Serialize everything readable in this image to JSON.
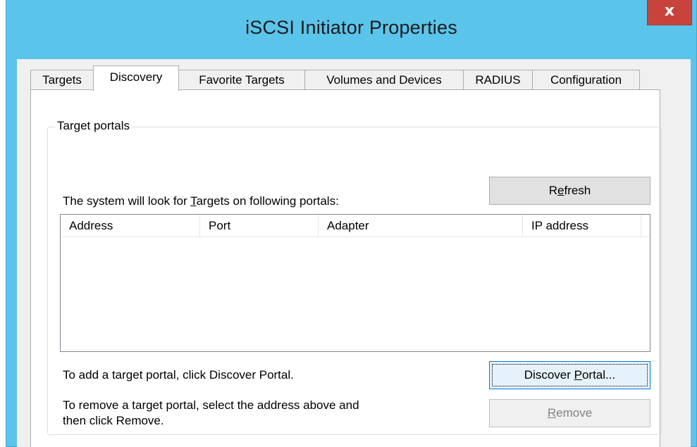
{
  "window": {
    "title": "iSCSI Initiator Properties",
    "close_label": "x"
  },
  "tabs": [
    {
      "label": "Targets",
      "active": false
    },
    {
      "label": "Discovery",
      "active": true
    },
    {
      "label": "Favorite Targets",
      "active": false
    },
    {
      "label": "Volumes and Devices",
      "active": false
    },
    {
      "label": "RADIUS",
      "active": false
    },
    {
      "label": "Configuration",
      "active": false
    }
  ],
  "discovery": {
    "group_label": "Target portals",
    "portals_caption_pre": "The system will look for ",
    "portals_caption_key": "T",
    "portals_caption_post": "argets on following portals:",
    "refresh": {
      "pre": "R",
      "key": "e",
      "post": "fresh"
    },
    "table": {
      "columns": [
        "Address",
        "Port",
        "Adapter",
        "IP address"
      ],
      "rows": []
    },
    "add_hint": "To add a target portal, click Discover Portal.",
    "discover_portal": {
      "pre": "Discover ",
      "key": "P",
      "post": "ortal..."
    },
    "remove_hint_line1": "To remove a target portal, select the address above and",
    "remove_hint_line2": "then click Remove.",
    "remove": {
      "pre": "",
      "key": "R",
      "post": "emove"
    }
  },
  "colors": {
    "titlebar": "#5bc4ea",
    "close_button": "#c8433c",
    "focus_border": "#0078d7"
  }
}
